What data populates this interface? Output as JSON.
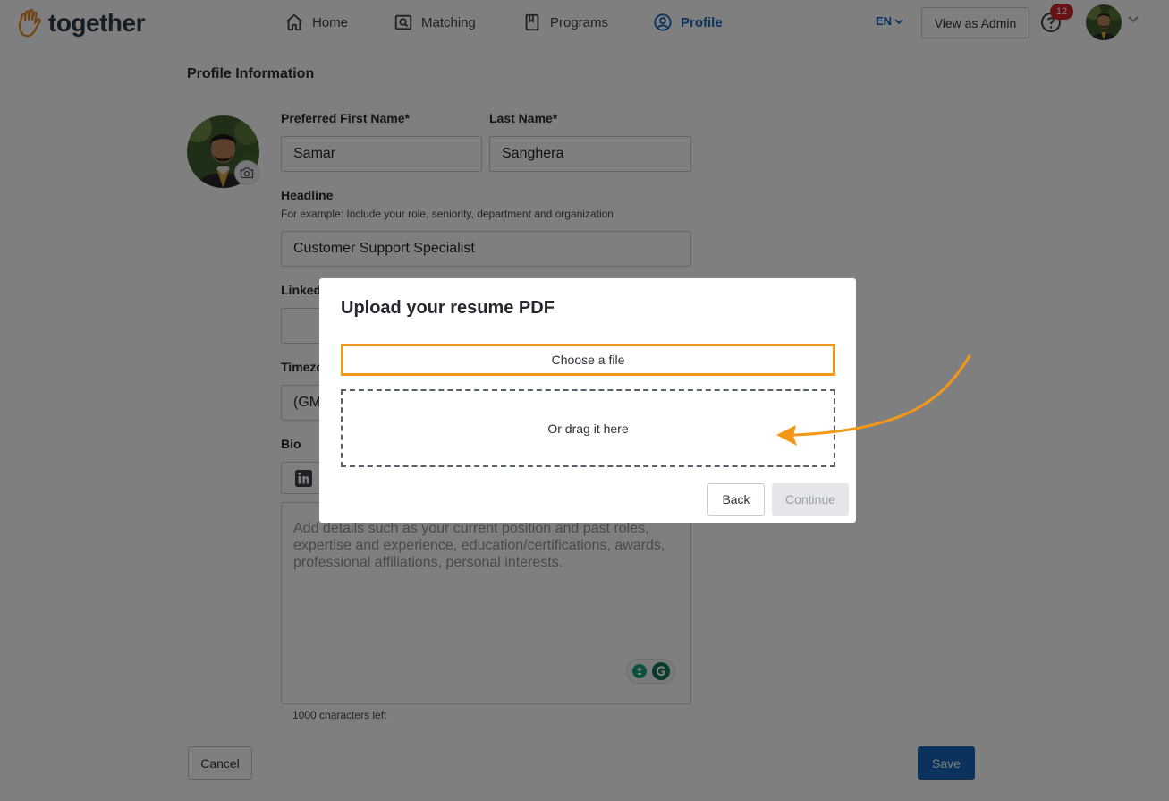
{
  "brand": {
    "name": "together",
    "accent": "#f39719",
    "primary": "#1664b8"
  },
  "nav": {
    "items": [
      {
        "label": "Home",
        "icon": "home-icon"
      },
      {
        "label": "Matching",
        "icon": "matching-icon"
      },
      {
        "label": "Programs",
        "icon": "book-icon"
      },
      {
        "label": "Profile",
        "icon": "profile-icon",
        "active": true
      }
    ],
    "language": "EN",
    "admin_button": "View as Admin",
    "notification_count": "12"
  },
  "profile": {
    "section_title": "Profile Information",
    "first_name_label": "Preferred First Name*",
    "first_name_value": "Samar",
    "last_name_label": "Last Name*",
    "last_name_value": "Sanghera",
    "headline_label": "Headline",
    "headline_hint": "For example: Include your role, seniority, department and organization",
    "headline_value": "Customer Support Specialist",
    "linkedin_label_partial": "Linked",
    "timezone_label_partial": "Timezo",
    "timezone_value_partial": "(GM",
    "bio_label": "Bio",
    "bio_placeholder": "Add details such as your current position and past roles, expertise and experience, education/certifications, awards, professional affiliations, personal interests.",
    "chars_left": "1000 characters left",
    "cancel": "Cancel",
    "save": "Save"
  },
  "modal": {
    "title": "Upload your resume PDF",
    "choose_file": "Choose a file",
    "drag_text": "Or drag it here",
    "back": "Back",
    "continue": "Continue"
  }
}
